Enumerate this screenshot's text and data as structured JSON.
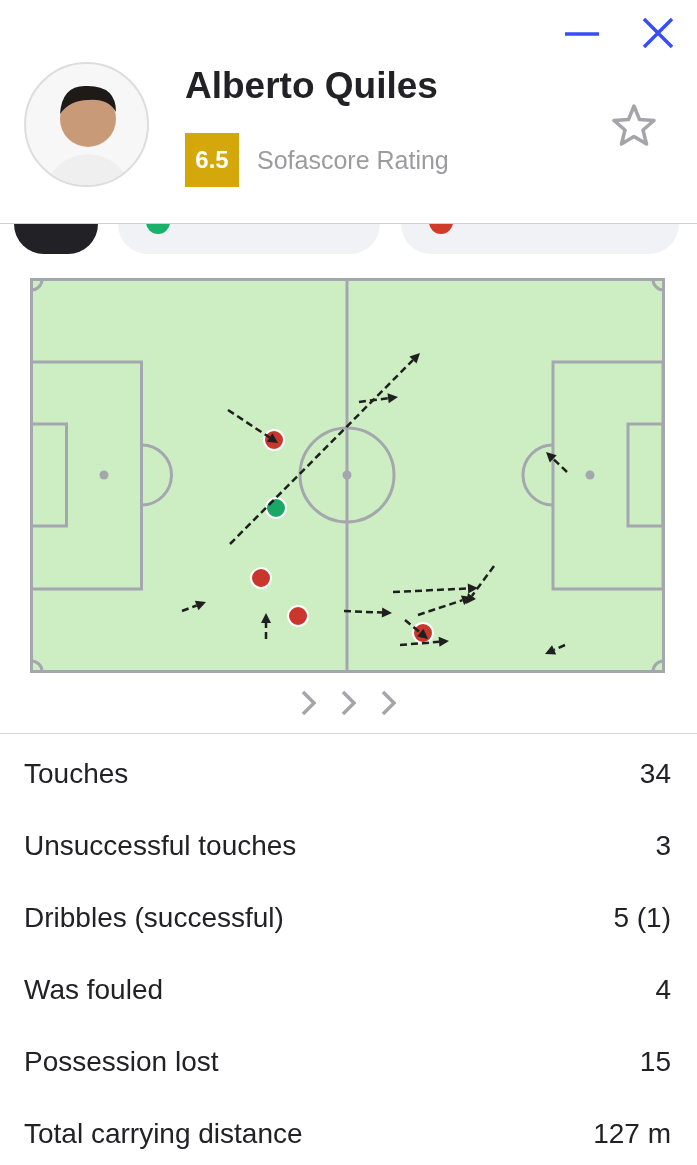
{
  "player": {
    "name": "Alberto Quiles",
    "rating": "6.5",
    "rating_label": "Sofascore Rating",
    "favorite": false
  },
  "filters": [
    {
      "selected": true
    },
    {
      "selected": false,
      "color": "#1ab26b"
    },
    {
      "selected": false,
      "color": "#d13c2a"
    }
  ],
  "dribbles": [
    {
      "color": "#c9372c"
    },
    {
      "color": "#1aa866"
    },
    {
      "color": "#c9372c"
    },
    {
      "color": "#c9372c"
    },
    {
      "color": "#c9372c"
    }
  ],
  "stats": [
    {
      "label": "Touches",
      "value": "34"
    },
    {
      "label": "Unsuccessful touches",
      "value": "3"
    },
    {
      "label": "Dribbles (successful)",
      "value": "5 (1)"
    },
    {
      "label": "Was fouled",
      "value": "4"
    },
    {
      "label": "Possession lost",
      "value": "15"
    },
    {
      "label": "Total carrying distance",
      "value": "127 m"
    }
  ]
}
